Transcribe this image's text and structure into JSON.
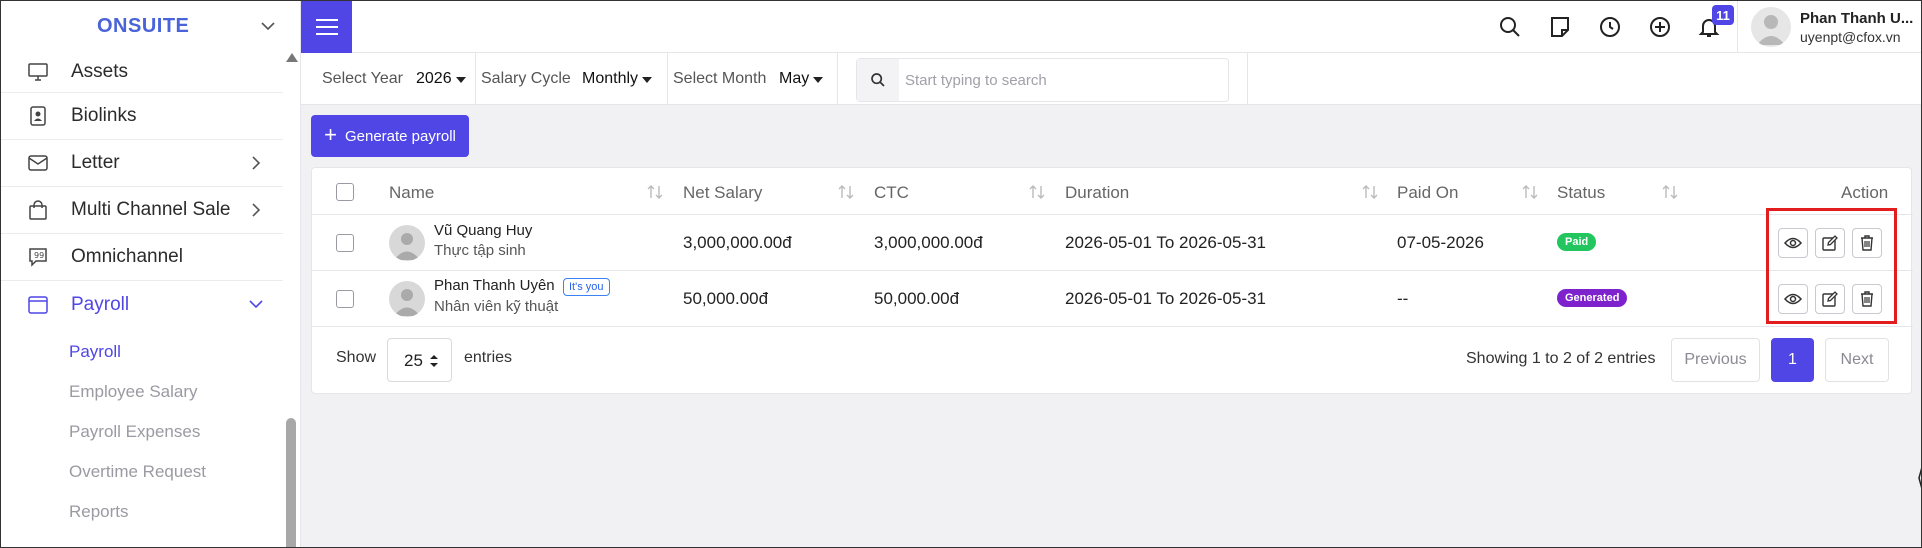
{
  "sidebar": {
    "brand": "ONSUITE",
    "items": [
      {
        "label": "Assets"
      },
      {
        "label": "Biolinks"
      },
      {
        "label": "Letter"
      },
      {
        "label": "Multi Channel Sale"
      },
      {
        "label": "Omnichannel"
      },
      {
        "label": "Payroll"
      }
    ],
    "submenu": [
      {
        "label": "Payroll"
      },
      {
        "label": "Employee Salary"
      },
      {
        "label": "Payroll Expenses"
      },
      {
        "label": "Overtime Request"
      },
      {
        "label": "Reports"
      }
    ]
  },
  "topbar": {
    "notification_count": "11",
    "user_name": "Phan Thanh U...",
    "user_email": "uyenpt@cfox.vn"
  },
  "filters": {
    "year_label": "Select Year",
    "year_value": "2026",
    "cycle_label": "Salary Cycle",
    "cycle_value": "Monthly",
    "month_label": "Select Month",
    "month_value": "May",
    "search_placeholder": "Start typing to search"
  },
  "actions": {
    "generate_label": "Generate payroll"
  },
  "table": {
    "headers": {
      "name": "Name",
      "net_salary": "Net Salary",
      "ctc": "CTC",
      "duration": "Duration",
      "paid_on": "Paid On",
      "status": "Status",
      "action": "Action"
    },
    "rows": [
      {
        "name": "Vũ Quang Huy",
        "role": "Thực tập sinh",
        "net_salary": "3,000,000.00đ",
        "ctc": "3,000,000.00đ",
        "duration": "2026-05-01 To 2026-05-31",
        "paid_on": "07-05-2026",
        "status": "Paid"
      },
      {
        "name": "Phan Thanh Uyên",
        "you_badge": "It's you",
        "role": "Nhân viên kỹ thuật",
        "net_salary": "50,000.00đ",
        "ctc": "50,000.00đ",
        "duration": "2026-05-01 To 2026-05-31",
        "paid_on": "--",
        "status": "Generated"
      }
    ]
  },
  "footer": {
    "show_label": "Show",
    "page_size": "25",
    "entries_label": "entries",
    "showing_text": "Showing 1 to 2 of 2 entries",
    "previous_label": "Previous",
    "current_page": "1",
    "next_label": "Next"
  },
  "colors": {
    "accent": "#4f46e5",
    "paid": "#22c55e",
    "generated": "#7e22ce",
    "highlight": "#e11d1d"
  }
}
